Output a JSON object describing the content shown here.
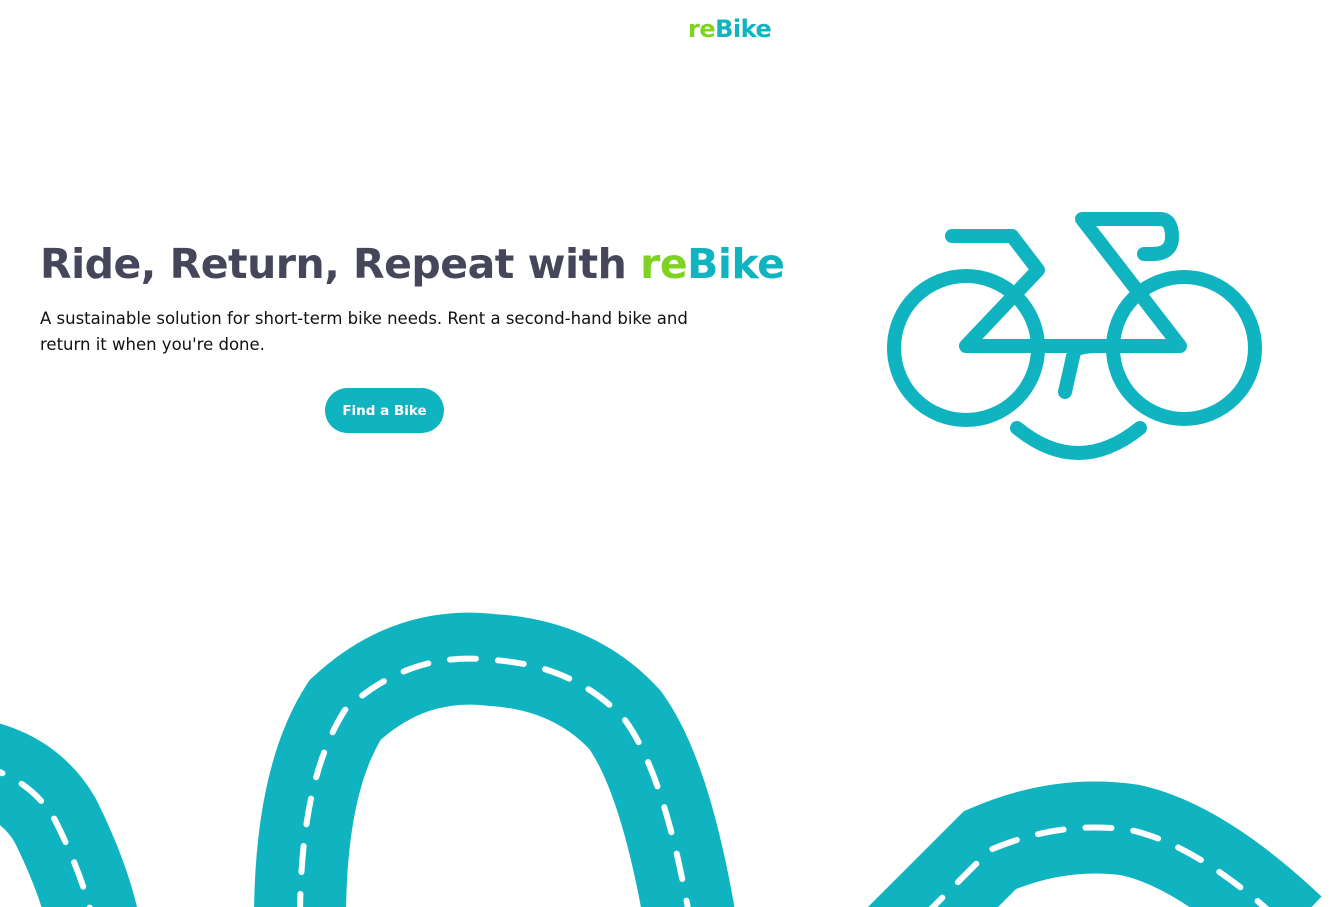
{
  "brand": {
    "prefix": "re",
    "suffix": "Bike"
  },
  "hero": {
    "title_main": "Ride, Return, Repeat with ",
    "title_brand_prefix": "re",
    "title_brand_suffix": "Bike",
    "subtitle": "A sustainable solution for short-term bike needs. Rent a second-hand bike and return it when you're done.",
    "cta_label": "Find a Bike"
  },
  "illustrations": {
    "hero_icon": "smiling-bike-icon",
    "background": "winding-road-illustration"
  },
  "colors": {
    "accent_teal": "#10b4c0",
    "accent_green": "#7ed321",
    "heading": "#45465a",
    "text": "#111111",
    "background": "#ffffff"
  }
}
